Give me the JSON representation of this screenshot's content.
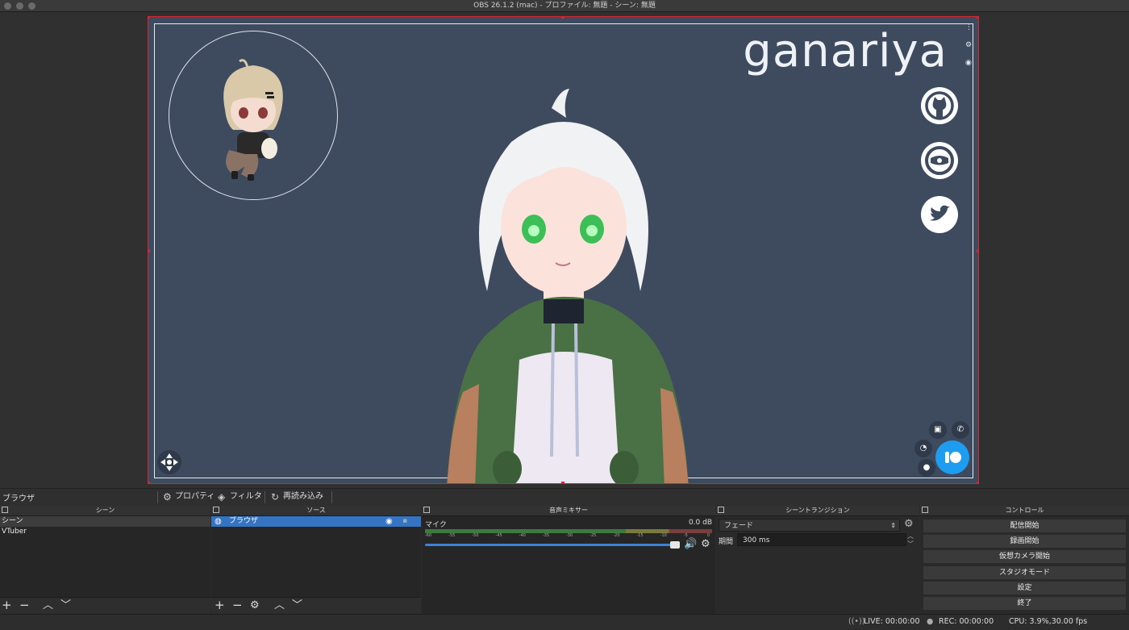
{
  "window": {
    "title": "OBS 26.1.2 (mac) - プロファイル: 無題 - シーン: 無題"
  },
  "preview": {
    "brand_text": "ganariya",
    "social_icons": [
      "github-icon",
      "circle-logo-icon",
      "twitter-icon"
    ],
    "colors": {
      "background": "#3e4a5e",
      "selection": "#d9232e",
      "widget_accent": "#1e9cf0"
    }
  },
  "source_toolbar": {
    "selected_source": "ブラウザ",
    "properties_label": "プロパティ",
    "filters_label": "フィルタ",
    "reload_label": "再読み込み"
  },
  "scenes": {
    "title": "シーン",
    "items": [
      "シーン",
      "VTuber"
    ]
  },
  "sources": {
    "title": "ソース",
    "items": [
      {
        "name": "ブラウザ",
        "visible": true,
        "locked": false
      }
    ]
  },
  "audio_mixer": {
    "title": "音声ミキサー",
    "channels": [
      {
        "name": "マイク",
        "level": "0.0 dB",
        "volume": 1.0
      }
    ],
    "scale": [
      "-60",
      "-55",
      "-50",
      "-45",
      "-40",
      "-35",
      "-30",
      "-25",
      "-20",
      "-15",
      "-10",
      "-5",
      "0"
    ]
  },
  "transitions": {
    "title": "シーントランジション",
    "transition": "フェード",
    "duration_label": "期間",
    "duration_value": "300 ms"
  },
  "controls": {
    "title": "コントロール",
    "buttons": [
      "配信開始",
      "録画開始",
      "仮想カメラ開始",
      "スタジオモード",
      "設定",
      "終了"
    ]
  },
  "status": {
    "live": "LIVE: 00:00:00",
    "rec": "REC: 00:00:00",
    "cpu": "CPU: 3.9%,30.00 fps"
  }
}
